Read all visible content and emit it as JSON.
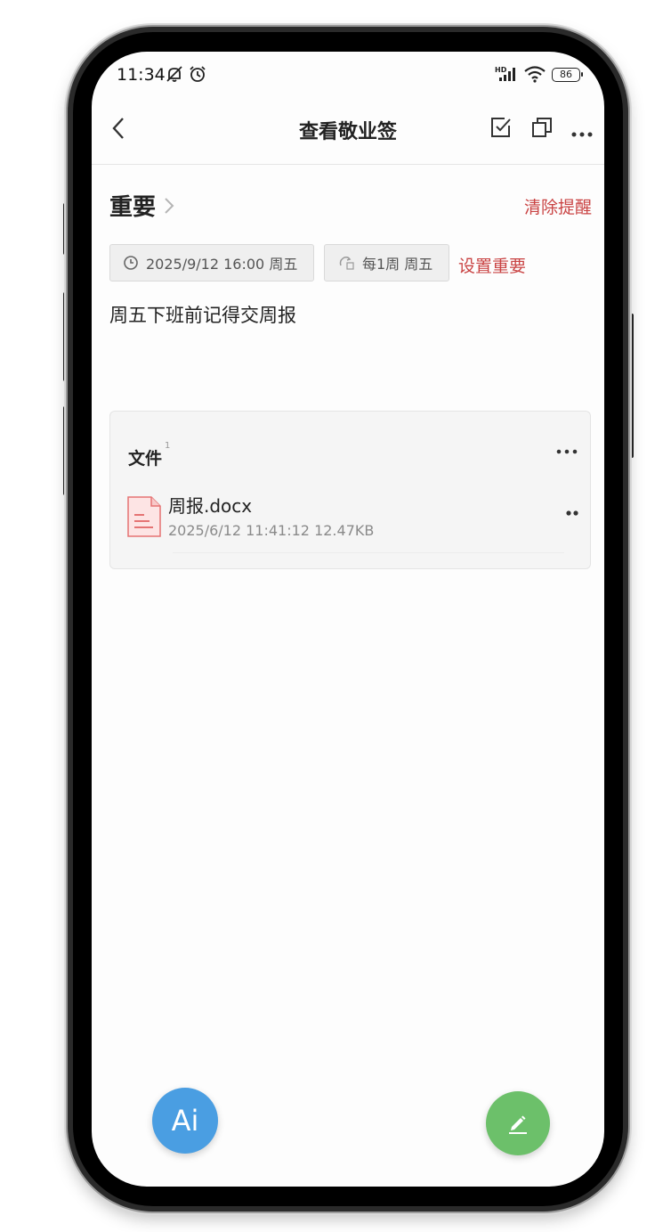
{
  "status_bar": {
    "time": "11:34",
    "network": "HD",
    "battery": "86"
  },
  "header": {
    "title": "查看敬业签"
  },
  "section": {
    "title": "重要",
    "clear_reminder": "清除提醒"
  },
  "reminder": {
    "datetime": "2025/9/12 16:00 周五",
    "repeat": "每1周 周五",
    "set_important": "设置重要"
  },
  "note": {
    "text": "周五下班前记得交周报"
  },
  "files": {
    "title": "文件",
    "count": "1",
    "items": [
      {
        "name": "周报.docx",
        "meta": "2025/6/12 11:41:12 12.47KB"
      }
    ]
  },
  "fab": {
    "ai_label": "Ai"
  },
  "colors": {
    "accent_red": "#c94343",
    "ai_blue": "#4a9ee2",
    "edit_green": "#6cc06a"
  }
}
